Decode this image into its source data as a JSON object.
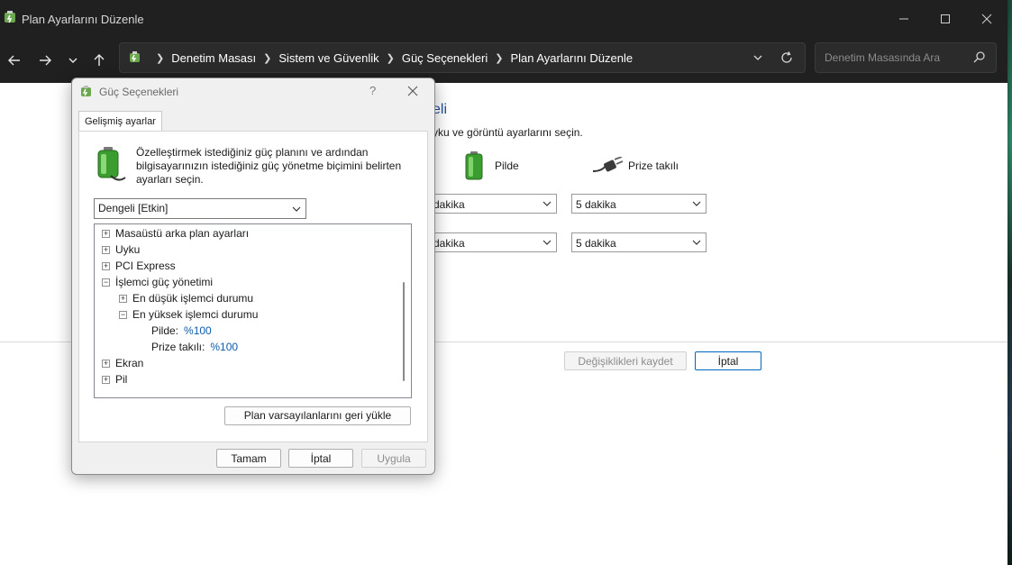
{
  "window": {
    "title": "Plan Ayarlarını Düzenle",
    "breadcrumbs": [
      "Denetim Masası",
      "Sistem ve Güvenlik",
      "Güç Seçenekleri",
      "Plan Ayarlarını Düzenle"
    ],
    "search_placeholder": "Denetim Masasında Ara"
  },
  "background": {
    "heading": "eli",
    "subtitle": "yku ve görüntü ayarlarını seçin.",
    "col_battery": "Pilde",
    "col_plugged": "Prize takılı",
    "rows": [
      {
        "battery": "dakika",
        "plugged": "5 dakika"
      },
      {
        "battery": "dakika",
        "plugged": "5 dakika"
      }
    ],
    "save_label": "Değişiklikleri kaydet",
    "cancel_label": "İptal"
  },
  "dialog": {
    "title": "Güç Seçenekleri",
    "help": "?",
    "tab_label": "Gelişmiş ayarlar",
    "description": "Özelleştirmek istediğiniz güç planını ve ardından bilgisayarınızın istediğiniz güç yönetme biçimini belirten ayarları seçin.",
    "plan_selected": "Dengeli [Etkin]",
    "tree": [
      {
        "label": "Masaüstü arka plan ayarları",
        "expander": "+"
      },
      {
        "label": "Uyku",
        "expander": "+"
      },
      {
        "label": "PCI Express",
        "expander": "+"
      },
      {
        "label": "İşlemci güç yönetimi",
        "expander": "−"
      },
      {
        "label": "En düşük işlemci durumu",
        "expander": "+"
      },
      {
        "label": "En yüksek işlemci durumu",
        "expander": "−"
      },
      {
        "label": "Pilde:",
        "value": "%100"
      },
      {
        "label": "Prize takılı:",
        "value": "%100"
      },
      {
        "label": "Ekran",
        "expander": "+"
      },
      {
        "label": "Pil",
        "expander": "+"
      }
    ],
    "restore_label": "Plan varsayılanlarını geri yükle",
    "ok_label": "Tamam",
    "cancel_label": "İptal",
    "apply_label": "Uygula"
  }
}
